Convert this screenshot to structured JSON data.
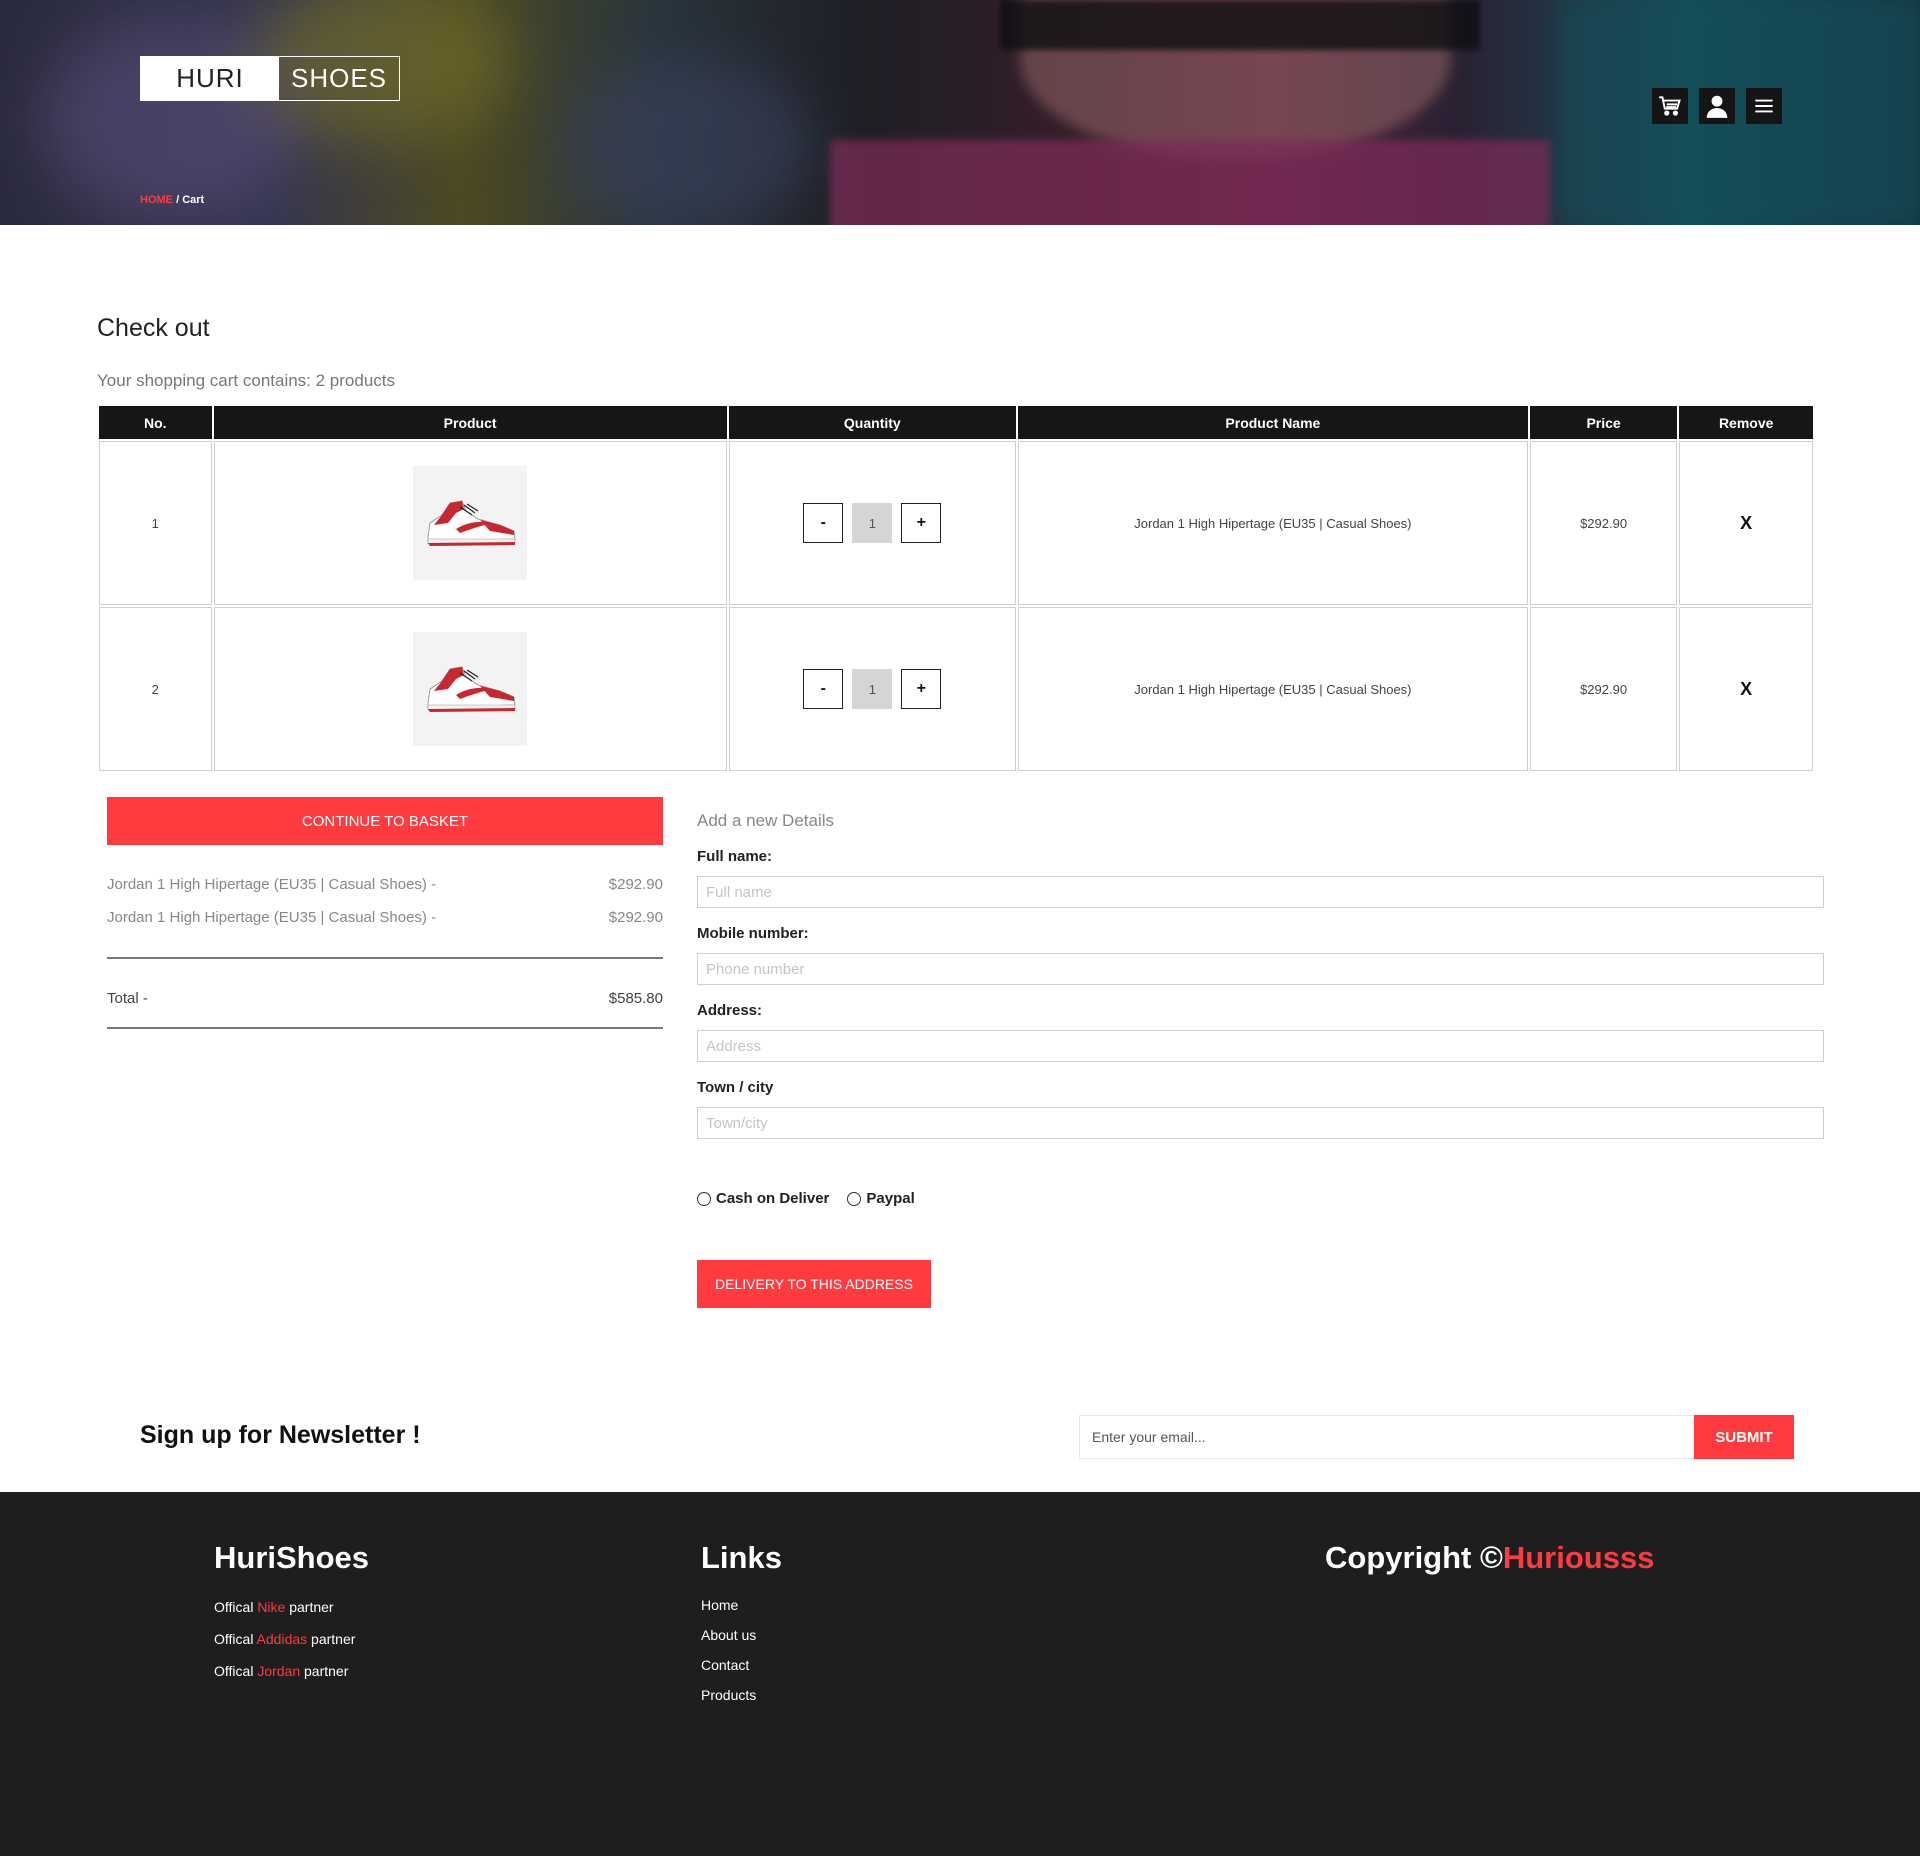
{
  "header": {
    "logo_left": "HURI",
    "logo_right": "SHOES",
    "breadcrumb": {
      "home": "HOME",
      "separator": "/",
      "current": "Cart"
    },
    "icons": [
      "cart-icon",
      "user-icon",
      "menu-icon"
    ]
  },
  "checkout": {
    "title": "Check out",
    "cart_summary": "Your shopping cart contains: 2 products",
    "columns": [
      "No.",
      "Product",
      "Quantity",
      "Product Name",
      "Price",
      "Remove"
    ],
    "rows": [
      {
        "no": "1",
        "qty_minus": "-",
        "quantity": "1",
        "qty_plus": "+",
        "name": "Jordan 1 High Hipertage (EU35 | Casual Shoes)",
        "price": "$292.90",
        "remove": "X"
      },
      {
        "no": "2",
        "qty_minus": "-",
        "quantity": "1",
        "qty_plus": "+",
        "name": "Jordan 1 High Hipertage (EU35 | Casual Shoes)",
        "price": "$292.90",
        "remove": "X"
      }
    ]
  },
  "summary": {
    "continue_label": "CONTINUE TO BASKET",
    "items": [
      {
        "name": "Jordan 1 High Hipertage (EU35 | Casual Shoes) -",
        "price": "$292.90"
      },
      {
        "name": "Jordan 1 High Hipertage (EU35 | Casual Shoes) -",
        "price": "$292.90"
      }
    ],
    "total_label": "Total -",
    "total_value": "$585.80"
  },
  "form": {
    "title": "Add a new Details",
    "full_name": {
      "label": "Full name:",
      "placeholder": "Full name",
      "value": ""
    },
    "mobile": {
      "label": "Mobile number:",
      "placeholder": "Phone number",
      "value": ""
    },
    "address": {
      "label": "Address:",
      "placeholder": "Address",
      "value": ""
    },
    "town": {
      "label": "Town / city",
      "placeholder": "Town/city",
      "value": ""
    },
    "payment_options": [
      "Cash on Deliver",
      "Paypal"
    ],
    "submit_label": "DELIVERY TO THIS ADDRESS"
  },
  "newsletter": {
    "title": "Sign up for Newsletter !",
    "placeholder": "Enter your email...",
    "submit_label": "SUBMIT"
  },
  "footer": {
    "brand_title": "HuriShoes",
    "partners": [
      {
        "prefix": "Offical ",
        "brand": "Nike",
        "suffix": " partner"
      },
      {
        "prefix": "Offical ",
        "brand": "Addidas",
        "suffix": " partner"
      },
      {
        "prefix": "Offical ",
        "brand": "Jordan",
        "suffix": " partner"
      }
    ],
    "links_title": "Links",
    "links": [
      "Home",
      "About us",
      "Contact",
      "Products"
    ],
    "copyright_prefix": "Copyright ©",
    "copyright_brand": "Huriousss"
  },
  "colors": {
    "accent": "#ff3b3f",
    "table_header": "#161616",
    "footer_bg": "#1e1e1e"
  }
}
